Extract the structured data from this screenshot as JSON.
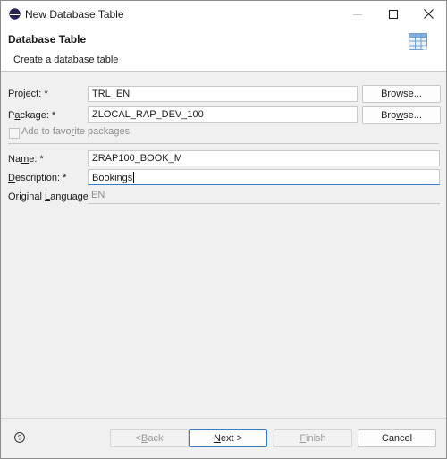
{
  "window": {
    "title": "New Database Table",
    "controls": {
      "minimize": "minimize",
      "maximize": "maximize",
      "close": "close"
    }
  },
  "banner": {
    "title": "Database Table",
    "subtitle": "Create a database table",
    "icon": "table-icon"
  },
  "form": {
    "project": {
      "label_prefix": "P",
      "label_rest": "roject: *",
      "value": "TRL_EN",
      "browse_label_prefix": "Br",
      "browse_label_u": "o",
      "browse_label_rest": "wse..."
    },
    "package": {
      "label_prefix": "P",
      "label_u": "a",
      "label_rest": "ckage: *",
      "value": "ZLOCAL_RAP_DEV_100",
      "browse_label_prefix": "Bro",
      "browse_label_u": "w",
      "browse_label_rest": "se..."
    },
    "favorites": {
      "label_prefix": "Add to favo",
      "label_u": "r",
      "label_rest": "ite packages",
      "checked": false
    },
    "name": {
      "label_prefix": "Na",
      "label_u": "m",
      "label_rest": "e: *",
      "value": "ZRAP100_BOOK_M"
    },
    "description": {
      "label_u": "D",
      "label_rest": "escription: *",
      "value": "Bookings"
    },
    "original_language": {
      "label_prefix": "Original ",
      "label_u": "L",
      "label_rest": "anguage:",
      "value": "EN"
    }
  },
  "footer": {
    "back_prefix": "< ",
    "back_u": "B",
    "back_rest": "ack",
    "next_u": "N",
    "next_rest": "ext >",
    "finish_u": "F",
    "finish_rest": "inish",
    "cancel": "Cancel"
  },
  "colors": {
    "accent": "#3a7cc8",
    "disabled_text": "#9a9a9a"
  }
}
